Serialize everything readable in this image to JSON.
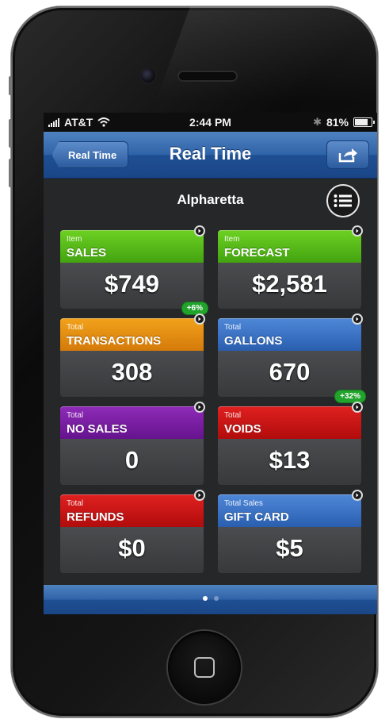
{
  "status_bar": {
    "carrier": "AT&T",
    "time": "2:44 PM",
    "battery": "81%",
    "battery_level": 0.81
  },
  "nav": {
    "back_label": "Real Time",
    "title": "Real Time"
  },
  "location": "Alpharetta",
  "cards": [
    {
      "sub": "Item",
      "title": "SALES",
      "value": "$749",
      "badge": "+6%",
      "color": "#5cbf1a"
    },
    {
      "sub": "Item",
      "title": "FORECAST",
      "value": "$2,581",
      "badge": "",
      "color": "#5cbf1a"
    },
    {
      "sub": "Total",
      "title": "TRANSACTIONS",
      "value": "308",
      "badge": "",
      "color": "#e48d12"
    },
    {
      "sub": "Total",
      "title": "GALLONS",
      "value": "670",
      "badge": "+32%",
      "color": "#3b74c4"
    },
    {
      "sub": "Total",
      "title": "NO SALES",
      "value": "0",
      "badge": "",
      "color": "#7a1fa3"
    },
    {
      "sub": "Total",
      "title": "VOIDS",
      "value": "$13",
      "badge": "",
      "color": "#c81616"
    },
    {
      "sub": "Total",
      "title": "REFUNDS",
      "value": "$0",
      "badge": "",
      "color": "#c81616"
    },
    {
      "sub": "Total Sales",
      "title": "GIFT CARD",
      "value": "$5",
      "badge": "",
      "color": "#3b74c4"
    }
  ],
  "pager": {
    "pages": 2,
    "current": 1
  },
  "icons": [
    "signal-icon",
    "wifi-icon",
    "bluetooth-icon",
    "battery-icon",
    "share-icon",
    "list-icon",
    "chevron-right-icon",
    "home-icon"
  ]
}
